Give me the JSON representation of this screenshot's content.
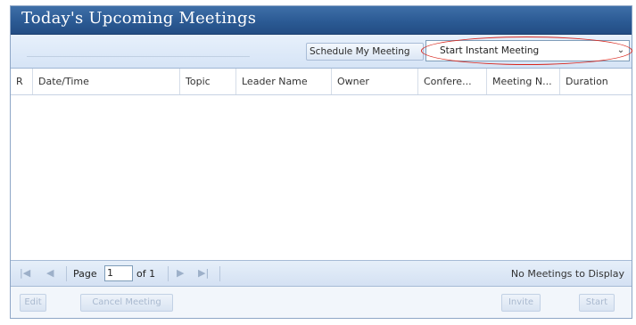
{
  "header": {
    "title": "Today's Upcoming Meetings"
  },
  "toolbar": {
    "schedule_label": "Schedule My Meeting",
    "meeting_select_value": "Start Instant Meeting",
    "dropdown_glyph": "⌄"
  },
  "grid": {
    "columns": [
      "R",
      "Date/Time",
      "Topic",
      "Leader Name",
      "Owner",
      "Confere...",
      "Meeting N...",
      "Duration"
    ],
    "rows": []
  },
  "pager": {
    "first_glyph": "|◀",
    "prev_glyph": "◀",
    "page_label": "Page",
    "page_value": "1",
    "of_label": "of 1",
    "next_glyph": "▶",
    "last_glyph": "▶|",
    "status": "No Meetings to Display"
  },
  "footer": {
    "edit_label": "Edit",
    "cancel_label": "Cancel Meeting",
    "invite_label": "Invite",
    "start_label": "Start"
  },
  "colors": {
    "title_bar": "#2b5a94",
    "highlight_oval": "#d8281f"
  }
}
